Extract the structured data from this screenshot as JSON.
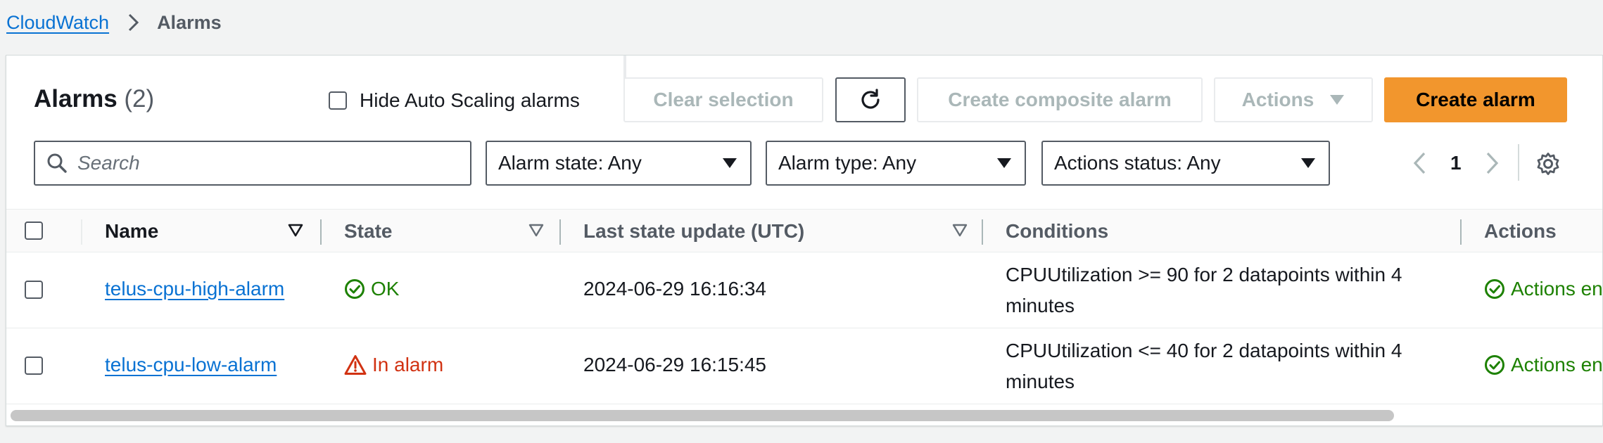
{
  "breadcrumb": {
    "root": "CloudWatch",
    "current": "Alarms"
  },
  "header": {
    "title": "Alarms",
    "count": "(2)",
    "hide_autoscaling_label": "Hide Auto Scaling alarms",
    "hide_autoscaling_checked": false
  },
  "toolbar": {
    "clear_selection": "Clear selection",
    "refresh_icon": "refresh-icon",
    "create_composite": "Create composite alarm",
    "actions": "Actions",
    "create_alarm": "Create alarm"
  },
  "filters": {
    "search_placeholder": "Search",
    "alarm_state": "Alarm state: Any",
    "alarm_type": "Alarm type: Any",
    "actions_status": "Actions status: Any"
  },
  "pagination": {
    "page": "1"
  },
  "table": {
    "columns": [
      "Name",
      "State",
      "Last state update (UTC)",
      "Conditions",
      "Actions"
    ],
    "rows": [
      {
        "name": "telus-cpu-high-alarm",
        "state": "OK",
        "state_kind": "ok",
        "last_update": "2024-06-29 16:16:34",
        "condition_line1": "CPUUtilization >= 90 for 2 datapoints within 4",
        "condition_line2": "minutes",
        "actions": "Actions enabled"
      },
      {
        "name": "telus-cpu-low-alarm",
        "state": "In alarm",
        "state_kind": "alarm",
        "last_update": "2024-06-29 16:15:45",
        "condition_line1": "CPUUtilization <= 40 for 2 datapoints within 4",
        "condition_line2": "minutes",
        "actions": "Actions enabled"
      }
    ]
  },
  "colors": {
    "link": "#0972d3",
    "ok": "#1d8102",
    "alarm": "#d13212",
    "primary": "#f2962d"
  }
}
